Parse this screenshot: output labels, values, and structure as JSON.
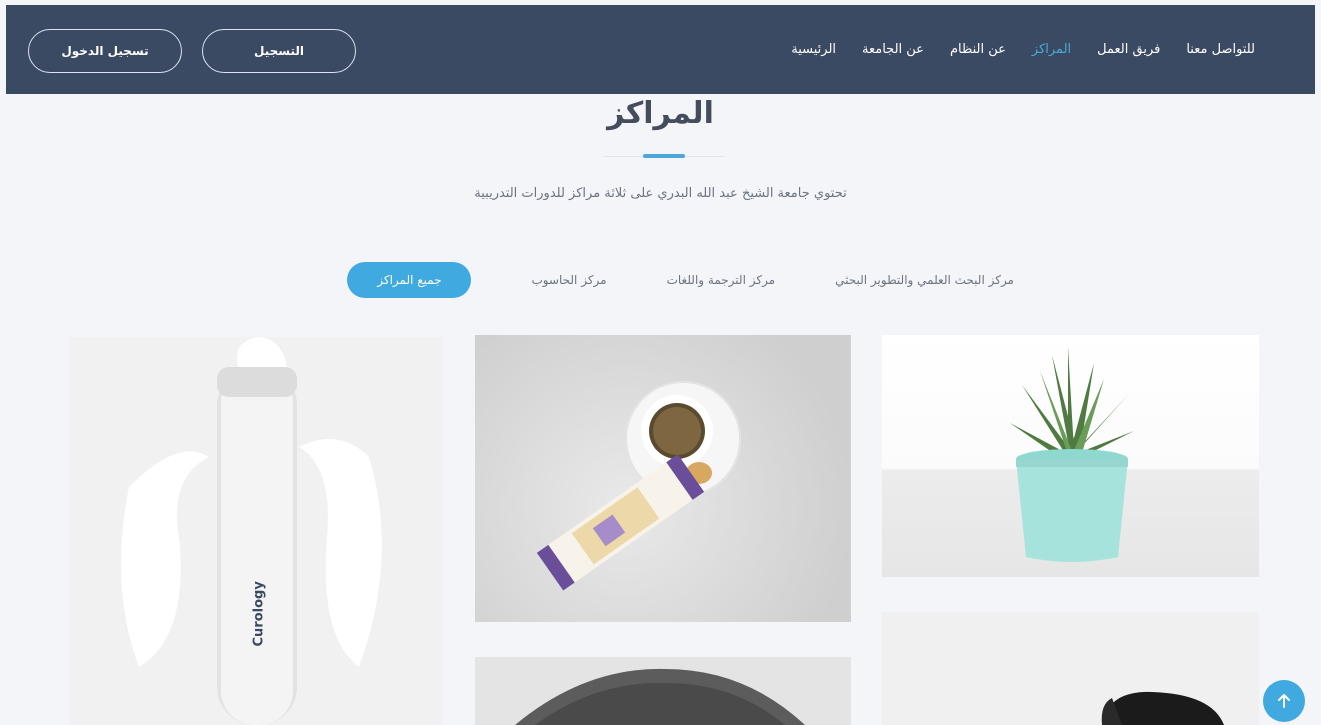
{
  "nav": {
    "links": [
      {
        "label": "الرئيسية",
        "active": false
      },
      {
        "label": "عن الجامعة",
        "active": false
      },
      {
        "label": "عن النظام",
        "active": false
      },
      {
        "label": "المراكز",
        "active": true
      },
      {
        "label": "فريق العمل",
        "active": false
      },
      {
        "label": "للتواصل معنا",
        "active": false
      }
    ],
    "register_label": "التسجيل",
    "login_label": "تسجيل الدخول"
  },
  "section": {
    "title": "المراكز",
    "description": "تحتوي جامعة الشيخ عبد الله البدري على ثلاثة مراكز للدورات التدريبية"
  },
  "tabs": [
    {
      "label": "جميع المراكز",
      "active": true
    },
    {
      "label": "مركز الحاسوب",
      "active": false
    },
    {
      "label": "مركز الترجمة واللغات",
      "active": false
    },
    {
      "label": "مركز البحث العلمي والتطوير البحثي",
      "active": false
    }
  ],
  "gallery": {
    "bottle_brand": "Curology"
  },
  "colors": {
    "navbar_bg": "#3b4a63",
    "accent": "#3fa9e0",
    "active_link": "#4aa8d8"
  },
  "icons": {
    "scroll_top": "arrow-up-icon"
  }
}
